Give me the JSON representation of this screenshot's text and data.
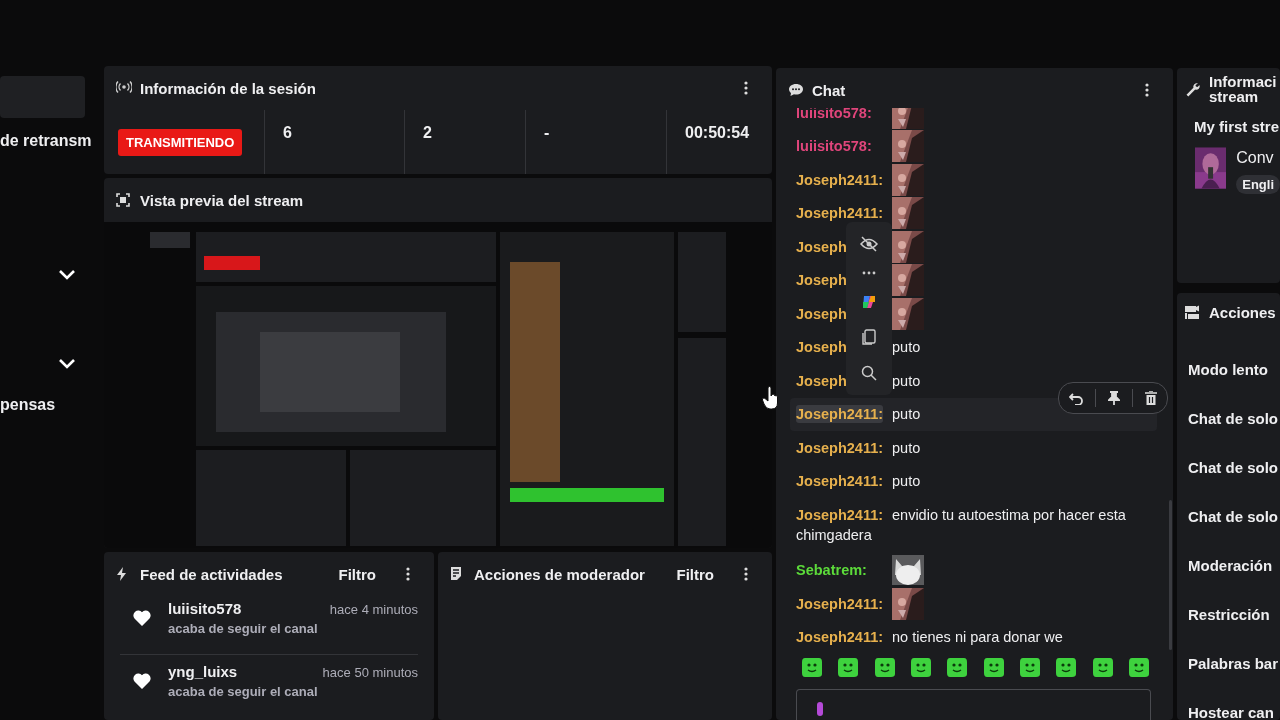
{
  "sidebar": {
    "labels": [
      "de retransm",
      "pensas"
    ]
  },
  "session": {
    "title": "Información de la sesión",
    "status": "TRANSMITIENDO",
    "stats": [
      "6",
      "2",
      "-",
      "00:50:54"
    ]
  },
  "preview": {
    "title": "Vista previa del stream"
  },
  "activity_feed": {
    "title": "Feed de actividades",
    "filter": "Filtro",
    "items": [
      {
        "user": "luiisito578",
        "time": "hace 4 minutos",
        "text": "acaba de seguir el canal"
      },
      {
        "user": "yng_luixs",
        "time": "hace 50 minutos",
        "text": "acaba de seguir el canal"
      }
    ]
  },
  "mod_actions": {
    "title": "Acciones de moderador",
    "filter": "Filtro"
  },
  "chat": {
    "title": "Chat",
    "messages": [
      {
        "user": "luiisito578:",
        "color": "#e0457b",
        "kind": "emote",
        "hovered": false
      },
      {
        "user": "luiisito578:",
        "color": "#e0457b",
        "kind": "emote",
        "hovered": false
      },
      {
        "user": "Joseph2411:",
        "color": "#e6b04d",
        "kind": "emote",
        "hovered": false
      },
      {
        "user": "Joseph2411:",
        "color": "#e6b04d",
        "kind": "emote",
        "hovered": false
      },
      {
        "user": "Joseph",
        "color": "#e6b04d",
        "kind": "emote",
        "hovered": false
      },
      {
        "user": "Joseph",
        "color": "#e6b04d",
        "kind": "emote",
        "hovered": false
      },
      {
        "user": "Joseph",
        "color": "#e6b04d",
        "kind": "emote",
        "hovered": false
      },
      {
        "user": "Joseph",
        "color": "#e6b04d",
        "kind": "text",
        "text_lines": [
          "puto"
        ],
        "hovered": false
      },
      {
        "user": "Joseph",
        "color": "#e6b04d",
        "kind": "text",
        "text_lines": [
          "puto"
        ],
        "hovered": false
      },
      {
        "user": "Joseph2411:",
        "color": "#e6b04d",
        "kind": "text",
        "text_lines": [
          "puto"
        ],
        "hovered": true
      },
      {
        "user": "Joseph2411:",
        "color": "#e6b04d",
        "kind": "text",
        "text_lines": [
          "puto"
        ],
        "hovered": false
      },
      {
        "user": "Joseph2411:",
        "color": "#e6b04d",
        "kind": "text",
        "text_lines": [
          "puto"
        ],
        "hovered": false
      },
      {
        "user": "Joseph2411:",
        "color": "#e6b04d",
        "kind": "text",
        "text_lines": [
          "envidio tu autoestima por hacer esta",
          "chimgadera"
        ],
        "hovered": false
      },
      {
        "user": "Sebatrem:",
        "color": "#5cdb3a",
        "kind": "emote",
        "hovered": false
      },
      {
        "user": "Joseph2411:",
        "color": "#e6b04d",
        "kind": "emote",
        "hovered": false
      },
      {
        "user": "Joseph2411:",
        "color": "#e6b04d",
        "kind": "text",
        "text_lines": [
          "no tienes ni para donar we"
        ],
        "hovered": false
      }
    ]
  },
  "stream_info": {
    "title_lines": [
      "Informaci",
      "stream"
    ],
    "stream_title": "My first stre",
    "category": "Conv",
    "tag": "Engli"
  },
  "actions": {
    "title": "Acciones",
    "items": [
      "Modo lento",
      "Chat de solo",
      "Chat de solo",
      "Chat de solo",
      "Moderación",
      "Restricción",
      "Palabras bar",
      "Hostear can"
    ]
  }
}
